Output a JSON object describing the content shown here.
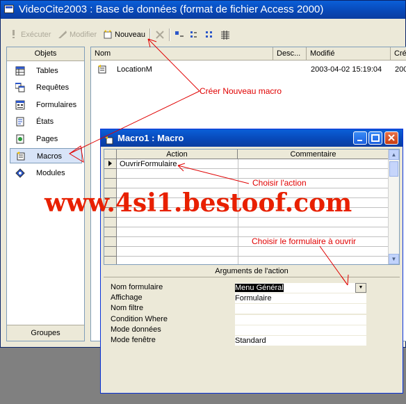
{
  "db_window": {
    "title": "VideoCite2003 : Base de données (format de fichier Access 2000)"
  },
  "toolbar": {
    "execute_label": "Exécuter",
    "modify_label": "Modifier",
    "new_label": "Nouveau"
  },
  "nav": {
    "header": "Objets",
    "items": [
      {
        "label": "Tables",
        "icon": "table-icon"
      },
      {
        "label": "Requêtes",
        "icon": "query-icon"
      },
      {
        "label": "Formulaires",
        "icon": "form-icon"
      },
      {
        "label": "États",
        "icon": "report-icon"
      },
      {
        "label": "Pages",
        "icon": "page-icon"
      },
      {
        "label": "Macros",
        "icon": "macro-icon"
      },
      {
        "label": "Modules",
        "icon": "module-icon"
      }
    ],
    "selected": "Macros",
    "footer": "Groupes"
  },
  "list": {
    "columns": [
      "Nom",
      "Desc...",
      "Modifié",
      "Cré"
    ],
    "rows": [
      {
        "name": "LocationM",
        "desc": "",
        "modified": "2003-04-02 15:19:04",
        "created": "200"
      }
    ]
  },
  "macro_window": {
    "title": "Macro1 : Macro",
    "col_action": "Action",
    "col_comment": "Commentaire",
    "row1_action": "OuvrirFormulaire",
    "args_title": "Arguments de l'action",
    "args": [
      {
        "label": "Nom formulaire",
        "value": "Menu Général"
      },
      {
        "label": "Affichage",
        "value": "Formulaire"
      },
      {
        "label": "Nom filtre",
        "value": ""
      },
      {
        "label": "Condition Where",
        "value": ""
      },
      {
        "label": "Mode données",
        "value": ""
      },
      {
        "label": "Mode fenêtre",
        "value": "Standard"
      }
    ]
  },
  "annotations": {
    "new_macro": "Créer Nouveau macro",
    "choose_action": "Choisir l'action",
    "choose_form": "Choisir le formulaire à ouvrir",
    "watermark": "www.4si1.bestoof.com",
    "color": "#e00000"
  }
}
